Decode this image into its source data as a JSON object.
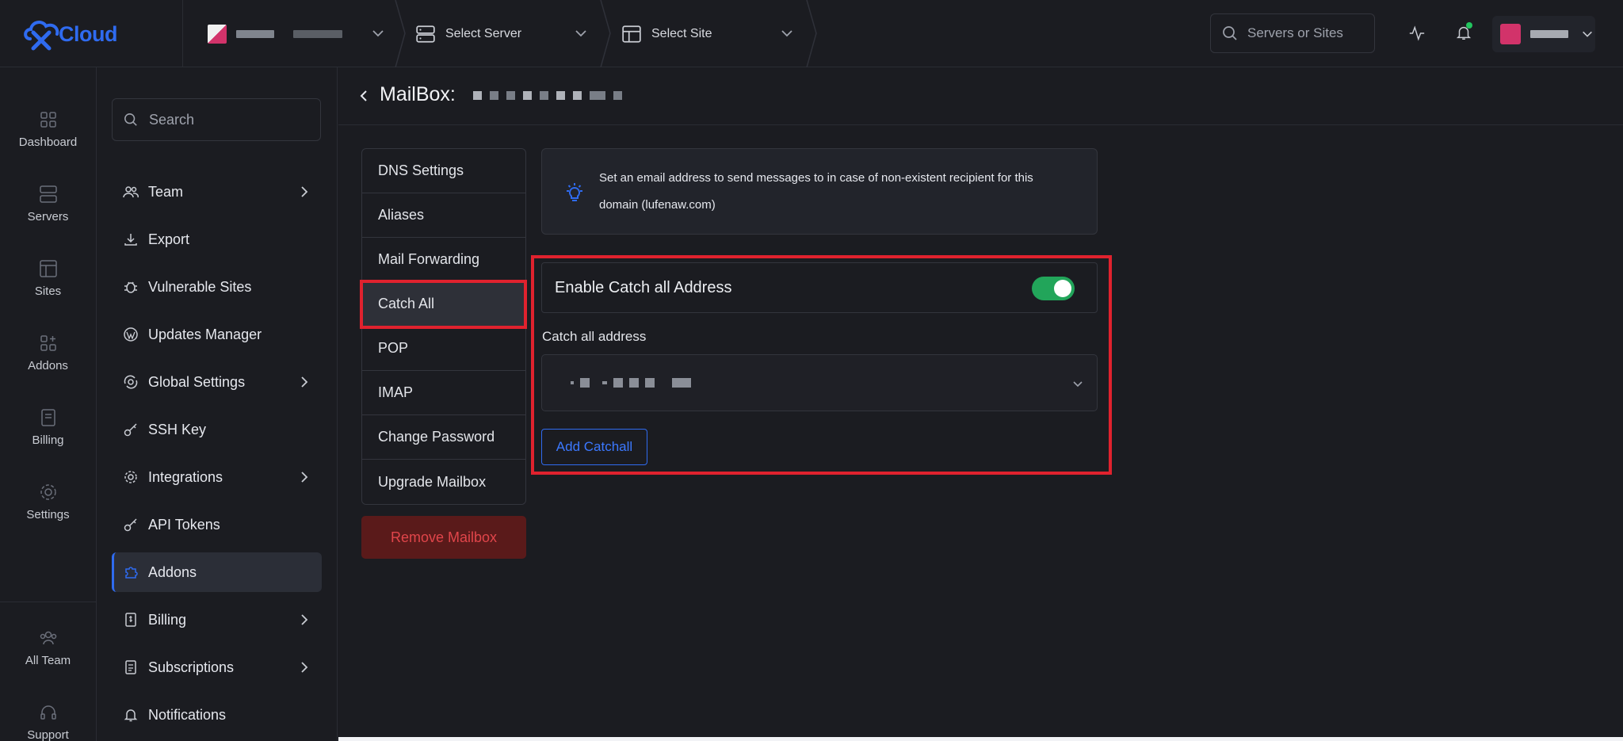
{
  "topbar": {
    "logo_text": "Cloud",
    "server_select": "Select Server",
    "site_select": "Select Site",
    "search_placeholder": "Servers or Sites"
  },
  "rail": {
    "items": [
      {
        "label": "Dashboard",
        "icon": "dashboard-icon"
      },
      {
        "label": "Servers",
        "icon": "servers-icon"
      },
      {
        "label": "Sites",
        "icon": "sites-icon"
      },
      {
        "label": "Addons",
        "icon": "addons-icon"
      },
      {
        "label": "Billing",
        "icon": "billing-icon"
      },
      {
        "label": "Settings",
        "icon": "gear-icon"
      }
    ],
    "bottom": [
      {
        "label": "All Team",
        "icon": "team-icon"
      },
      {
        "label": "Support",
        "icon": "headset-icon"
      }
    ]
  },
  "sidebar": {
    "search_placeholder": "Search",
    "items": [
      {
        "label": "Team",
        "icon": "users-icon",
        "has_arrow": true
      },
      {
        "label": "Export",
        "icon": "download-icon",
        "has_arrow": false
      },
      {
        "label": "Vulnerable Sites",
        "icon": "bug-icon",
        "has_arrow": false
      },
      {
        "label": "Updates Manager",
        "icon": "wordpress-icon",
        "has_arrow": false
      },
      {
        "label": "Global Settings",
        "icon": "global-settings-icon",
        "has_arrow": true
      },
      {
        "label": "SSH Key",
        "icon": "key-icon",
        "has_arrow": false
      },
      {
        "label": "Integrations",
        "icon": "gear-icon",
        "has_arrow": true
      },
      {
        "label": "API Tokens",
        "icon": "key-icon",
        "has_arrow": false
      },
      {
        "label": "Addons",
        "icon": "puzzle-icon",
        "has_arrow": false,
        "active": true
      },
      {
        "label": "Billing",
        "icon": "invoice-icon",
        "has_arrow": true
      },
      {
        "label": "Subscriptions",
        "icon": "receipt-icon",
        "has_arrow": true
      },
      {
        "label": "Notifications",
        "icon": "bell-icon",
        "has_arrow": false
      }
    ]
  },
  "main": {
    "title": "MailBox:",
    "tabs": [
      {
        "label": "DNS Settings"
      },
      {
        "label": "Aliases"
      },
      {
        "label": "Mail Forwarding"
      },
      {
        "label": "Catch All",
        "active": true
      },
      {
        "label": "POP"
      },
      {
        "label": "IMAP"
      },
      {
        "label": "Change Password"
      },
      {
        "label": "Upgrade Mailbox"
      }
    ],
    "remove_button": "Remove Mailbox",
    "info_text": "Set an email address to send messages to in case of non-existent recipient for this domain (lufenaw.com)",
    "toggle_label": "Enable Catch all Address",
    "toggle_on": true,
    "field_label": "Catch all address",
    "add_button": "Add Catchall"
  },
  "colors": {
    "accent": "#2f6bf0",
    "toggle_on": "#22a55a",
    "highlight": "#e0222e",
    "danger_bg": "#5a1a1a"
  }
}
